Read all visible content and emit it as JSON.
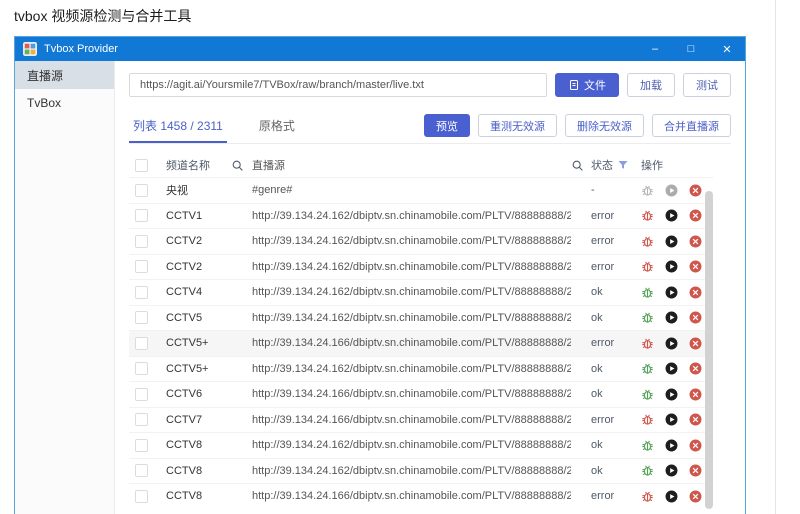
{
  "page": {
    "heading": "tvbox 视频源检测与合并工具"
  },
  "window": {
    "title": "Tvbox Provider",
    "controls": {
      "minimize": "–",
      "maximize": "□",
      "close": "✕"
    }
  },
  "sidebar": {
    "items": [
      {
        "label": "直播源",
        "active": true
      },
      {
        "label": "TvBox",
        "active": false
      }
    ]
  },
  "toolbar": {
    "url_value": "https://agit.ai/Yoursmile7/TVBox/raw/branch/master/live.txt",
    "file_button": "文件",
    "load_button": "加载",
    "test_button": "测试"
  },
  "tabs": [
    {
      "label": "列表 1458 / 2311",
      "active": true
    },
    {
      "label": "原格式",
      "active": false
    }
  ],
  "actions": {
    "preview": "预览",
    "retest_invalid": "重测无效源",
    "delete_invalid": "删除无效源",
    "merge_sources": "合并直播源"
  },
  "table": {
    "headers": {
      "name": "频道名称",
      "source": "直播源",
      "status": "状态",
      "ops": "操作"
    },
    "rows": [
      {
        "name": "央视",
        "source": "#genre#",
        "status": "-"
      },
      {
        "name": "CCTV1",
        "source": "http://39.134.24.162/dbiptv.sn.chinamobile.com/PLTV/88888888/2...",
        "status": "error"
      },
      {
        "name": "CCTV2",
        "source": "http://39.134.24.162/dbiptv.sn.chinamobile.com/PLTV/88888888/2...",
        "status": "error"
      },
      {
        "name": "CCTV2",
        "source": "http://39.134.24.162/dbiptv.sn.chinamobile.com/PLTV/88888888/2...",
        "status": "error"
      },
      {
        "name": "CCTV4",
        "source": "http://39.134.24.162/dbiptv.sn.chinamobile.com/PLTV/88888888/2...",
        "status": "ok"
      },
      {
        "name": "CCTV5",
        "source": "http://39.134.24.162/dbiptv.sn.chinamobile.com/PLTV/88888888/2...",
        "status": "ok"
      },
      {
        "name": "CCTV5+",
        "source": "http://39.134.24.166/dbiptv.sn.chinamobile.com/PLTV/88888888/2...",
        "status": "error",
        "highlighted": true
      },
      {
        "name": "CCTV5+",
        "source": "http://39.134.24.162/dbiptv.sn.chinamobile.com/PLTV/88888888/2...",
        "status": "ok"
      },
      {
        "name": "CCTV6",
        "source": "http://39.134.24.166/dbiptv.sn.chinamobile.com/PLTV/88888888/2...",
        "status": "ok"
      },
      {
        "name": "CCTV7",
        "source": "http://39.134.24.166/dbiptv.sn.chinamobile.com/PLTV/88888888/2...",
        "status": "error"
      },
      {
        "name": "CCTV8",
        "source": "http://39.134.24.162/dbiptv.sn.chinamobile.com/PLTV/88888888/2...",
        "status": "ok"
      },
      {
        "name": "CCTV8",
        "source": "http://39.134.24.162/dbiptv.sn.chinamobile.com/PLTV/88888888/2...",
        "status": "ok"
      },
      {
        "name": "CCTV8",
        "source": "http://39.134.24.166/dbiptv.sn.chinamobile.com/PLTV/88888888/2...",
        "status": "error"
      }
    ]
  },
  "colors": {
    "titlebar_blue": "#1278d6",
    "primary_blue": "#4a5fd0",
    "link_blue": "#4a5fc9",
    "danger_red": "#d0564c",
    "success_green": "#54a158",
    "sidebar_active": "#d9dfe6"
  }
}
